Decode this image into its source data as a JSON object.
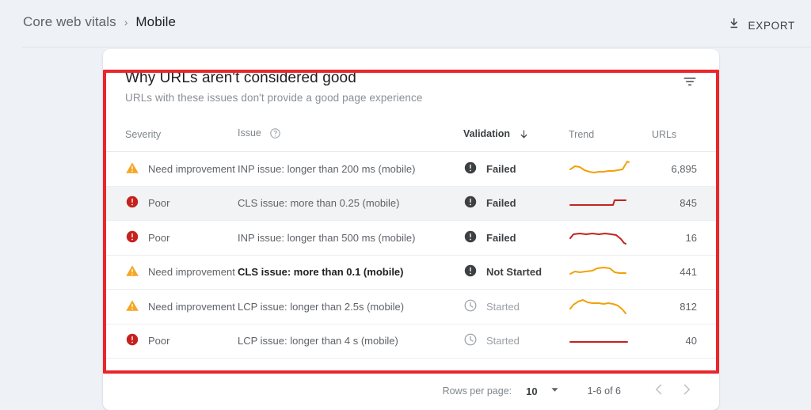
{
  "header": {
    "breadcrumb": {
      "parent": "Core web vitals",
      "separator": "›",
      "current": "Mobile"
    },
    "export": {
      "label": "EXPORT",
      "icon": "download-icon"
    }
  },
  "card": {
    "title": "Why URLs aren't considered good",
    "subtitle": "URLs with these issues don't provide a good page experience",
    "filter_icon": "filter-icon",
    "table": {
      "columns": [
        {
          "key": "severity",
          "label": "Severity",
          "sorted": false
        },
        {
          "key": "issue",
          "label": "Issue",
          "sorted": false,
          "help_icon": "help-circle-icon"
        },
        {
          "key": "validation",
          "label": "Validation",
          "sorted": true,
          "sort_icon": "arrow-down-icon"
        },
        {
          "key": "trend",
          "label": "Trend",
          "sorted": false
        },
        {
          "key": "urls",
          "label": "URLs",
          "sorted": false
        }
      ],
      "rows": [
        {
          "severity": "Need improvement",
          "severity_icon": "warning-triangle-icon",
          "severity_color": "#f5a623",
          "issue": "INP issue: longer than 200 ms (mobile)",
          "issue_emphasis": false,
          "validation": "Failed",
          "validation_icon": "error-filled-icon",
          "validation_state": "failed",
          "trend_color": "#f2a10a",
          "urls": "6,895",
          "highlighted": false
        },
        {
          "severity": "Poor",
          "severity_icon": "error-filled-icon",
          "severity_color": "#c5221f",
          "issue": "CLS issue: more than 0.25 (mobile)",
          "issue_emphasis": false,
          "validation": "Failed",
          "validation_icon": "error-filled-icon",
          "validation_state": "failed",
          "trend_color": "#c5221f",
          "urls": "845",
          "highlighted": true
        },
        {
          "severity": "Poor",
          "severity_icon": "error-filled-icon",
          "severity_color": "#c5221f",
          "issue": "INP issue: longer than 500 ms (mobile)",
          "issue_emphasis": false,
          "validation": "Failed",
          "validation_icon": "error-filled-icon",
          "validation_state": "failed",
          "trend_color": "#c5221f",
          "urls": "16",
          "highlighted": false
        },
        {
          "severity": "Need improvement",
          "severity_icon": "warning-triangle-icon",
          "severity_color": "#f5a623",
          "issue": "CLS issue: more than 0.1 (mobile)",
          "issue_emphasis": true,
          "validation": "Not Started",
          "validation_icon": "error-filled-icon",
          "validation_state": "not-started",
          "trend_color": "#f2a10a",
          "urls": "441",
          "highlighted": false
        },
        {
          "severity": "Need improvement",
          "severity_icon": "warning-triangle-icon",
          "severity_color": "#f5a623",
          "issue": "LCP issue: longer than 2.5s (mobile)",
          "issue_emphasis": false,
          "validation": "Started",
          "validation_icon": "clock-outline-icon",
          "validation_state": "started",
          "trend_color": "#f2a10a",
          "urls": "812",
          "highlighted": false
        },
        {
          "severity": "Poor",
          "severity_icon": "error-filled-icon",
          "severity_color": "#c5221f",
          "issue": "LCP issue: longer than 4 s (mobile)",
          "issue_emphasis": false,
          "validation": "Started",
          "validation_icon": "clock-outline-icon",
          "validation_state": "started",
          "trend_color": "#c5221f",
          "urls": "40",
          "highlighted": false
        }
      ]
    },
    "footer": {
      "rows_per_page_label": "Rows per page:",
      "rows_per_page_value": "10",
      "dropdown_icon": "chevron-down-icon",
      "range": "1-6 of 6",
      "prev_icon": "chevron-left-icon",
      "next_icon": "chevron-right-icon"
    }
  },
  "annotation": {
    "color": "#e8262b"
  },
  "colors": {
    "page_background": "#eef1f6",
    "card_background": "#ffffff",
    "row_highlight": "#f1f3f4",
    "warning": "#f5a623",
    "error": "#c5221f",
    "status_dark": "#3c4043",
    "muted_text": "#80868b"
  },
  "sparklines": {
    "row0": "2,18 8,14 14,15 20,19 26,21 32,22 38,21 44,21 50,20 56,20 62,19 68,18 74,8 76,9",
    "row1": "2,20 30,20 56,20 58,14 64,14 72,14",
    "row2": "2,18 6,13 14,12 22,13 30,12 38,13 46,12 54,13 60,14 66,19 70,24 72,25",
    "row3": "2,20 8,17 14,18 22,17 30,16 36,13 44,12 52,13 58,18 64,19 72,19",
    "row4": "2,20 6,15 12,11 18,9 24,12 30,13 38,13 44,14 50,13 56,14 62,16 68,21 72,26",
    "row5": "2,19 20,19 40,19 60,19 74,19"
  }
}
